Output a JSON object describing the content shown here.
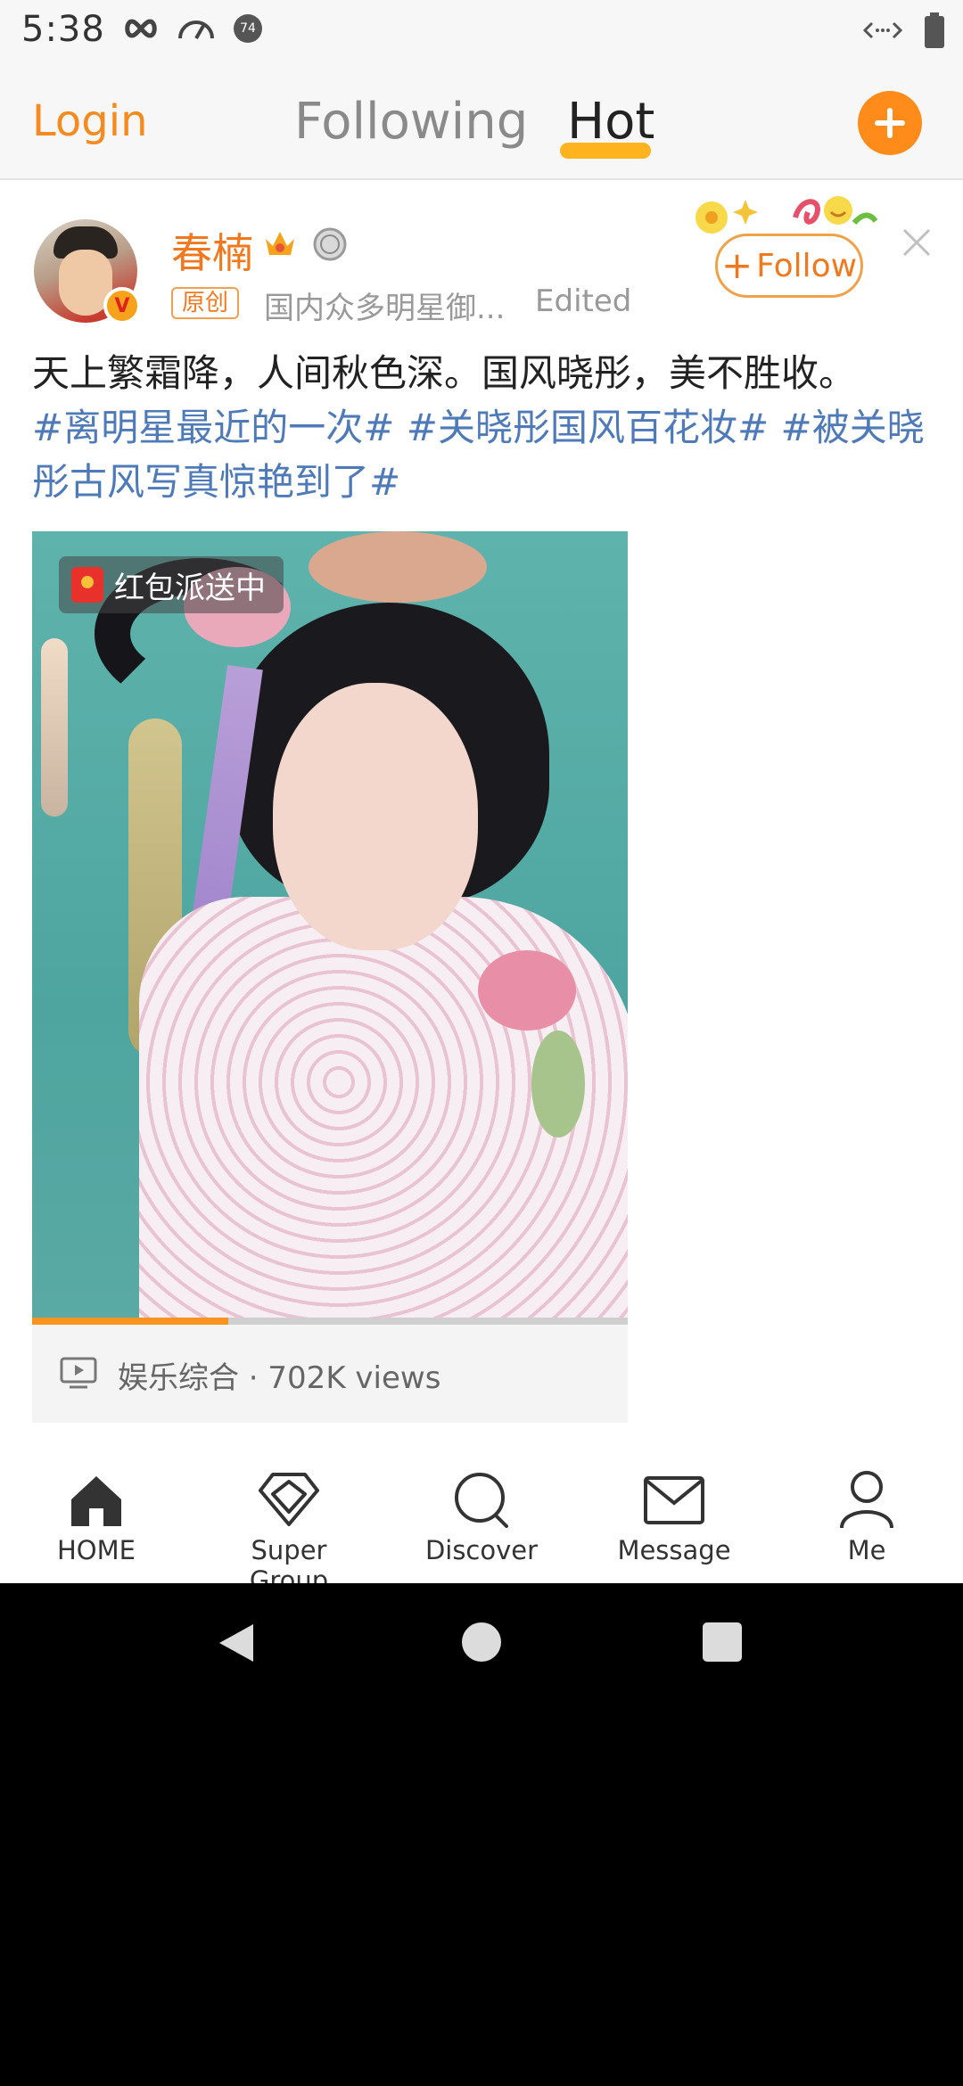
{
  "status_bar": {
    "time": "5:38",
    "icons_left": [
      "infinity-icon",
      "speedometer-icon",
      "notification-badge-icon"
    ],
    "notification_badge_text": "74",
    "icons_right": [
      "code-arrows-icon",
      "battery-icon"
    ]
  },
  "top_nav": {
    "login": "Login",
    "tabs": [
      {
        "label": "Following",
        "active": false
      },
      {
        "label": "Hot",
        "active": true
      }
    ],
    "add_icon": "plus-icon",
    "accent_color": "#ff8c1a"
  },
  "post": {
    "username": "春楠",
    "verified_mark": "V",
    "original_tag": "原创",
    "source": "国内众多明星御...",
    "edited": "Edited",
    "follow_label": "Follow",
    "text_plain": "天上繁霜降，人间秋色深。国风晓彤，美不胜收。",
    "hashtags": [
      "#离明星最近的一次#",
      "#关晓彤国风百花妆#",
      "#被关晓彤古风写真惊艳到了#"
    ],
    "video": {
      "red_packet_label": "红包派送中",
      "progress": 0.33,
      "meta": "娱乐综合 · 702K views"
    }
  },
  "tab_bar": {
    "items": [
      {
        "label": "HOME",
        "icon": "home-icon"
      },
      {
        "label": "Super Group",
        "icon": "diamond-icon"
      },
      {
        "label": "Discover",
        "icon": "search-icon"
      },
      {
        "label": "Message",
        "icon": "envelope-icon"
      },
      {
        "label": "Me",
        "icon": "person-icon"
      }
    ]
  },
  "colors": {
    "orange": "#f0791f",
    "hashtag_blue": "#4f7ab8",
    "hot_underline": "#ffb41f"
  }
}
